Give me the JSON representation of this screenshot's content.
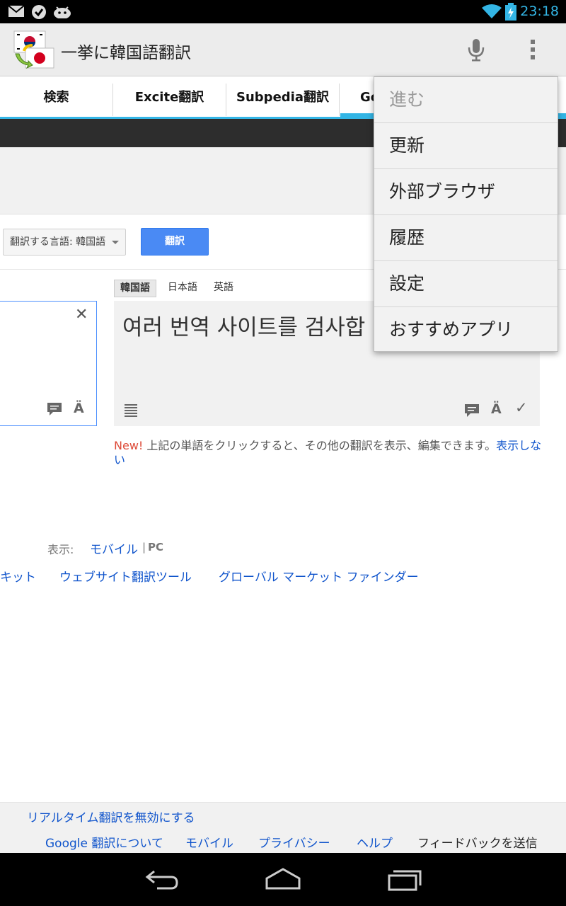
{
  "status_bar": {
    "time": "23:18",
    "icons": [
      "gmail-icon",
      "task-icon",
      "android-icon",
      "wifi-icon",
      "battery-icon"
    ]
  },
  "action_bar": {
    "title": "一挙に韓国語翻訳",
    "icons": [
      "app-flags-icon",
      "microphone-icon",
      "overflow-menu-icon"
    ]
  },
  "tabs": [
    {
      "label": "検索"
    },
    {
      "label": "Excite翻訳"
    },
    {
      "label": "Subpedia翻訳"
    },
    {
      "label": "Go"
    }
  ],
  "translate_page": {
    "source_language_select": "翻訳する言語: 韓国語",
    "translate_button": "翻訳",
    "target_tabs": [
      "韓国語",
      "日本語",
      "英語"
    ],
    "result_text": "여러 번역 사이트를 검사합",
    "notice_new": "New!",
    "notice_text": " 上記の単語をクリックすると、その他の翻訳を表示、編集できます。",
    "notice_hide": "表示しない",
    "display_label": "表示:",
    "display_mobile": "モバイル",
    "display_sep": "|",
    "display_pc": "PC",
    "tool_links": [
      "キット",
      "ウェブサイト翻訳ツール",
      "グローバル マーケット ファインダー"
    ]
  },
  "footer": {
    "realtime_toggle": "リアルタイム翻訳を無効にする",
    "about": "Google 翻訳について",
    "mobile": "モバイル",
    "privacy": "プライバシー",
    "help": "ヘルプ",
    "feedback": "フィードバックを送信"
  },
  "overflow_menu": {
    "items": [
      {
        "label": "進む",
        "enabled": false
      },
      {
        "label": "更新",
        "enabled": true
      },
      {
        "label": "外部ブラウザ",
        "enabled": true
      },
      {
        "label": "履歴",
        "enabled": true
      },
      {
        "label": "設定",
        "enabled": true
      },
      {
        "label": "おすすめアプリ",
        "enabled": true
      }
    ]
  },
  "colors": {
    "accent": "#33b5e5",
    "link": "#1155cc",
    "button_blue": "#4a8af4",
    "new_red": "#dd4b39"
  }
}
